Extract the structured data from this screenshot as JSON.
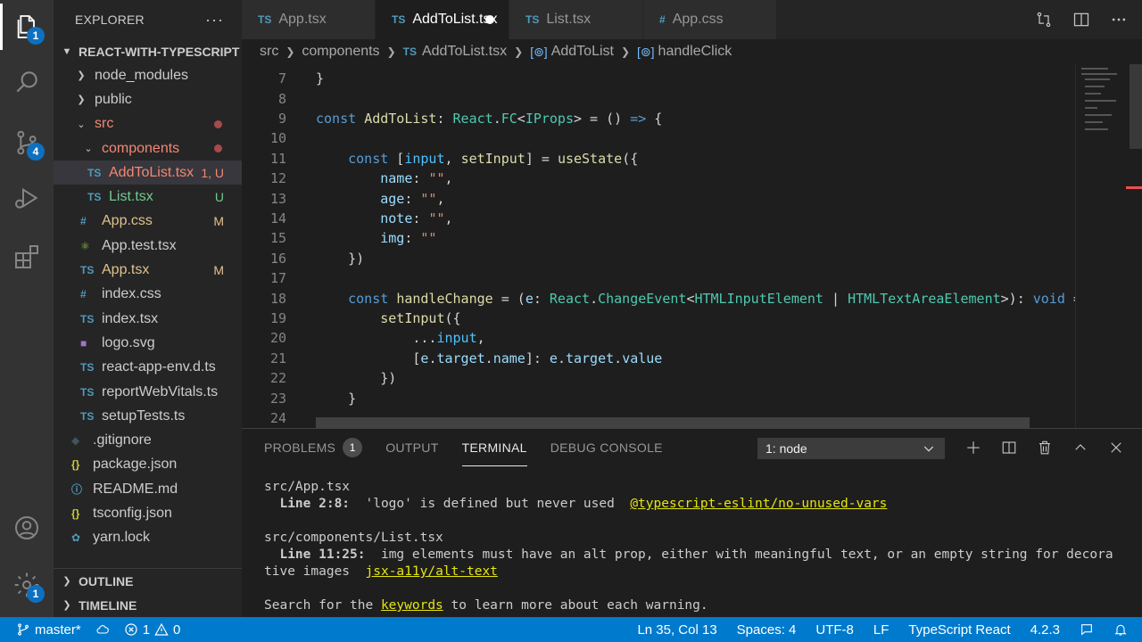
{
  "activity_bar": {
    "explorer_badge": "1",
    "scm_badge": "4",
    "settings_badge": "1"
  },
  "sidebar": {
    "title": "EXPLORER",
    "more": "···",
    "project": "REACT-WITH-TYPESCRIPT",
    "items": [
      {
        "label": "node_modules",
        "icon": "chevron-right",
        "deco": ""
      },
      {
        "label": "public",
        "icon": "chevron-right",
        "deco": ""
      },
      {
        "label": "src",
        "icon": "chevron-down",
        "deco": "dot"
      },
      {
        "label": "components",
        "icon": "chevron-down",
        "deco": "dot"
      },
      {
        "label": "AddToList.tsx",
        "icon": "TS",
        "deco": "1, U"
      },
      {
        "label": "List.tsx",
        "icon": "TS",
        "deco": "U"
      },
      {
        "label": "App.css",
        "icon": "#",
        "deco": "M"
      },
      {
        "label": "App.test.tsx",
        "icon": "react-icon",
        "deco": ""
      },
      {
        "label": "App.tsx",
        "icon": "TS",
        "deco": "M"
      },
      {
        "label": "index.css",
        "icon": "#",
        "deco": ""
      },
      {
        "label": "index.tsx",
        "icon": "TS",
        "deco": ""
      },
      {
        "label": "logo.svg",
        "icon": "svg-icon",
        "deco": ""
      },
      {
        "label": "react-app-env.d.ts",
        "icon": "TS",
        "deco": ""
      },
      {
        "label": "reportWebVitals.ts",
        "icon": "TS",
        "deco": ""
      },
      {
        "label": "setupTests.ts",
        "icon": "TS",
        "deco": ""
      },
      {
        "label": ".gitignore",
        "icon": "git-icon",
        "deco": ""
      },
      {
        "label": "package.json",
        "icon": "{}",
        "deco": ""
      },
      {
        "label": "README.md",
        "icon": "info-icon",
        "deco": ""
      },
      {
        "label": "tsconfig.json",
        "icon": "{}",
        "deco": ""
      },
      {
        "label": "yarn.lock",
        "icon": "yarn-icon",
        "deco": ""
      }
    ],
    "outline": "OUTLINE",
    "timeline": "TIMELINE"
  },
  "tabs": [
    {
      "icon": "TS",
      "label": "App.tsx"
    },
    {
      "icon": "TS",
      "label": "AddToList.tsx"
    },
    {
      "icon": "TS",
      "label": "List.tsx"
    },
    {
      "icon": "#",
      "label": "App.css"
    }
  ],
  "breadcrumbs": {
    "src": "src",
    "components": "components",
    "file_icon": "TS",
    "file": "AddToList.tsx",
    "symbol1": "AddToList",
    "symbol2": "handleClick"
  },
  "editor": {
    "line_numbers": [
      "7",
      "8",
      "9",
      "10",
      "11",
      "12",
      "13",
      "14",
      "15",
      "16",
      "17",
      "18",
      "19",
      "20",
      "21",
      "22",
      "23",
      "24"
    ]
  },
  "panel": {
    "tabs": [
      "PROBLEMS",
      "OUTPUT",
      "TERMINAL",
      "DEBUG CONSOLE"
    ],
    "problems_count": "1",
    "terminal_select": "1: node",
    "terminal": {
      "l1": "src/App.tsx",
      "l2_pos": "  Line 2:8:",
      "l2_msg": "  'logo' is defined but never used  ",
      "l2_rule": "@typescript-eslint/no-unused-vars",
      "l4": "src/components/List.tsx",
      "l5_pos": "  Line 11:25:",
      "l5_msg": "  img elements must have an alt prop, either with meaningful text, or an empty string for decora",
      "l6_msg": "tive images  ",
      "l6_rule": "jsx-a11y/alt-text",
      "l8_a": "Search for the ",
      "l8_link": "keywords",
      "l8_b": " to learn more about each warning."
    }
  },
  "status": {
    "branch": "master*",
    "errors": "1",
    "warnings": "0",
    "position": "Ln 35, Col 13",
    "spaces": "Spaces: 4",
    "encoding": "UTF-8",
    "eol": "LF",
    "language": "TypeScript React",
    "version": "4.2.3"
  },
  "colors": {
    "status_bar": "#007acc",
    "activity_bar": "#333333",
    "sidebar": "#252526",
    "editor": "#1e1e1e"
  }
}
